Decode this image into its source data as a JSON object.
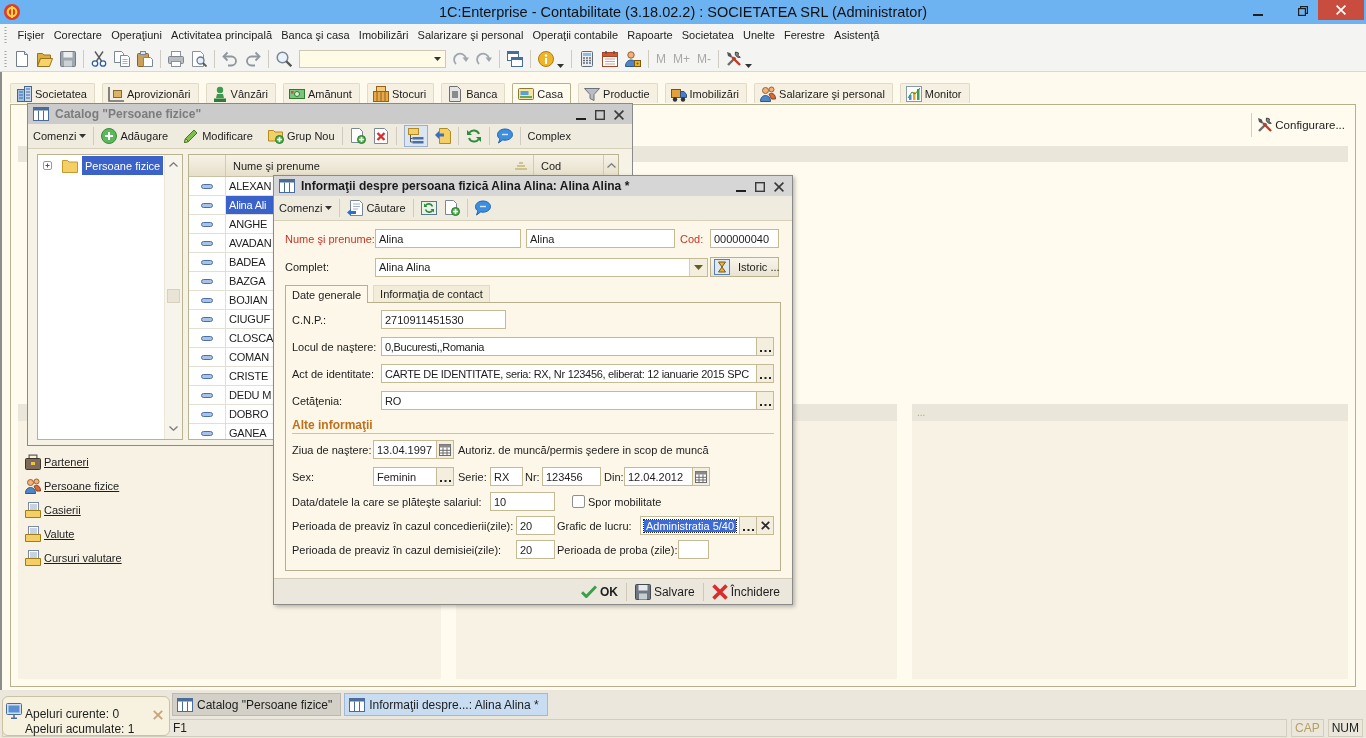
{
  "window": {
    "title": "1C:Enterprise - Contabilitate (3.18.02.2) : SOCIETATEA SRL (Administrator)"
  },
  "menu": [
    "Fişier",
    "Corectare",
    "Operaţiuni",
    "Activitatea principală",
    "Banca şi casa",
    "Imobilizări",
    "Salarizare şi personal",
    "Operaţii contabile",
    "Rapoarte",
    "Societatea",
    "Unelte",
    "Ferestre",
    "Asistenţă"
  ],
  "toolbar": {
    "memory_buttons": [
      {
        "label": "M",
        "disabled": true
      },
      {
        "label": "M+",
        "disabled": true
      },
      {
        "label": "M-",
        "disabled": true
      }
    ]
  },
  "section_tabs": [
    {
      "label": "Societatea",
      "selected": false
    },
    {
      "label": "Aprovizionări",
      "selected": false
    },
    {
      "label": "Vânzări",
      "selected": false
    },
    {
      "label": "Amănunt",
      "selected": false
    },
    {
      "label": "Stocuri",
      "selected": false
    },
    {
      "label": "Banca",
      "selected": false
    },
    {
      "label": "Casa",
      "selected": true
    },
    {
      "label": "Productie",
      "selected": false
    },
    {
      "label": "Imobilizări",
      "selected": false
    },
    {
      "label": "Salarizare şi personal",
      "selected": false
    },
    {
      "label": "Monitor",
      "selected": false
    }
  ],
  "function_panel": {
    "configure_button": "Configurare...",
    "links": [
      "Parteneri",
      "Persoane fizice",
      "Casierii",
      "Valute",
      "Cursuri valutare"
    ],
    "right_panel_title": "..."
  },
  "catalog_window": {
    "title": "Catalog \"Persoane fizice\"",
    "active": false,
    "toolbar": {
      "menu": "Comenzi",
      "buttons": [
        "Adăugare",
        "Modificare",
        "Grup Nou"
      ],
      "hierarchy_pressed": true,
      "mode_button": "Complex"
    },
    "tree": [
      {
        "label": "Persoane fizice",
        "selected": true,
        "expanded": false
      }
    ],
    "columns": [
      "Nume şi prenume",
      "Cod"
    ],
    "rows": [
      {
        "name": "ALEXAN",
        "selected": false
      },
      {
        "name": "Alina Ali",
        "selected": true
      },
      {
        "name": "ANGHE",
        "selected": false
      },
      {
        "name": "AVADAN",
        "selected": false
      },
      {
        "name": "BADEA",
        "selected": false
      },
      {
        "name": "BAZGA",
        "selected": false
      },
      {
        "name": "BOJIAN",
        "selected": false
      },
      {
        "name": "CIUGUF",
        "selected": false
      },
      {
        "name": "CLOSCA",
        "selected": false
      },
      {
        "name": "COMAN",
        "selected": false
      },
      {
        "name": "CRISTE",
        "selected": false
      },
      {
        "name": "DEDU M",
        "selected": false
      },
      {
        "name": "DOBRO",
        "selected": false
      },
      {
        "name": "GANEA",
        "selected": false
      }
    ]
  },
  "person_form": {
    "title": "Informaţii despre persoana fizică Alina Alina: Alina Alina *",
    "active": true,
    "toolbar": {
      "menu": "Comenzi",
      "search_button": "Căutare"
    },
    "name": {
      "label": "Nume şi prenume:",
      "required": true,
      "last_name": "Alina",
      "first_name": "Alina"
    },
    "code": {
      "label": "Cod:",
      "required": true,
      "value": "000000040"
    },
    "full_name": {
      "label": "Complet:",
      "value": "Alina Alina"
    },
    "history_button": "Istoric ...",
    "tabs": [
      {
        "label": "Date generale",
        "selected": true
      },
      {
        "label": "Informaţia de contact",
        "selected": false
      }
    ],
    "general_fields": [
      {
        "label": "C.N.P.:",
        "value": "2710911451530",
        "kind": "text"
      },
      {
        "label": "Locul de naştere:",
        "value": "0,Bucuresti,,Romania",
        "kind": "choice"
      },
      {
        "label": "Act de identitate:",
        "value": "CARTE DE IDENTITATE, seria: RX, Nr 123456, eliberat: 12 ianuarie 2015 SPC",
        "kind": "choice"
      },
      {
        "label": "Cetăţenia:",
        "value": "RO",
        "kind": "choice"
      }
    ],
    "section_title": "Alte informaţii",
    "birth_date": {
      "label": "Ziua de naştere:",
      "value": "13.04.1997"
    },
    "work_permit_label": "Autoriz. de muncă/permis şedere in scop de muncă",
    "sex": {
      "label": "Sex:",
      "value": "Feminin"
    },
    "series": {
      "label": "Serie:",
      "value": "RX"
    },
    "number": {
      "label": "Nr:",
      "value": "123456"
    },
    "issued": {
      "label": "Din:",
      "value": "12.04.2012"
    },
    "pay_dates": {
      "label": "Data/datele la care se plăteşte salariul:",
      "value": "10"
    },
    "mobility_bonus": {
      "label": "Spor mobilitate",
      "checked": false
    },
    "dismissal_notice": {
      "label": "Perioada de preaviz în cazul concedierii(zile):",
      "value": "20"
    },
    "work_schedule": {
      "label": "Grafic de lucru:",
      "value": "Administratia 5/40",
      "focused": true
    },
    "resignation_notice": {
      "label": "Perioada de preaviz în cazul demisiei(zile):",
      "value": "20"
    },
    "probation": {
      "label": "Perioada de proba (zile):"
    },
    "buttons": [
      {
        "label": "OK",
        "kind": "ok"
      },
      {
        "label": "Salvare",
        "kind": "save"
      },
      {
        "label": "Închidere",
        "kind": "close"
      }
    ]
  },
  "window_tabs": [
    {
      "label": "Catalog \"Persoane fizice\"",
      "selected": false
    },
    {
      "label": "Informaţii despre...: Alina Alina *",
      "selected": true
    }
  ],
  "notification": {
    "lines": [
      "Apeluri curente: 0",
      "Apeluri acumulate: 1"
    ]
  },
  "status_bar": {
    "hint": "F1",
    "indicators": [
      {
        "label": "CAP",
        "on": false
      },
      {
        "label": "NUM",
        "on": true
      }
    ]
  }
}
